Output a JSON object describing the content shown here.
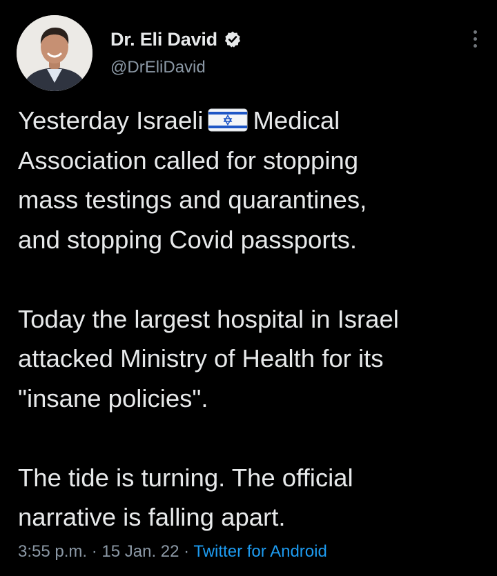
{
  "author": {
    "display_name": "Dr. Eli David",
    "handle": "@DrEliDavid",
    "avatar_icon": "profile-photo",
    "verified_icon": "verified-badge-icon"
  },
  "tweet": {
    "line1_before_flag": "Yesterday Israeli",
    "flag_icon": "israel-flag-emoji",
    "line1_after_flag": "Medical",
    "lines_p1_rest": [
      "Association called for stopping",
      "mass testings and quarantines,",
      "and stopping Covid passports."
    ],
    "lines_p2": [
      "Today the largest hospital in Israel",
      "attacked Ministry of Health for its",
      "\"insane policies\"."
    ],
    "lines_p3": [
      "The tide is turning. The official",
      "narrative is falling apart."
    ]
  },
  "meta": {
    "time": "3:55 p.m.",
    "separator": " · ",
    "date": "15 Jan. 22",
    "source": "Twitter for Android"
  },
  "more_icon": "more-vertical-icon",
  "colors": {
    "background": "#000000",
    "text_primary": "#e7e9ea",
    "text_secondary": "#8b98a5",
    "link": "#1d9bf0",
    "verified_badge": "#e7e9ea"
  }
}
